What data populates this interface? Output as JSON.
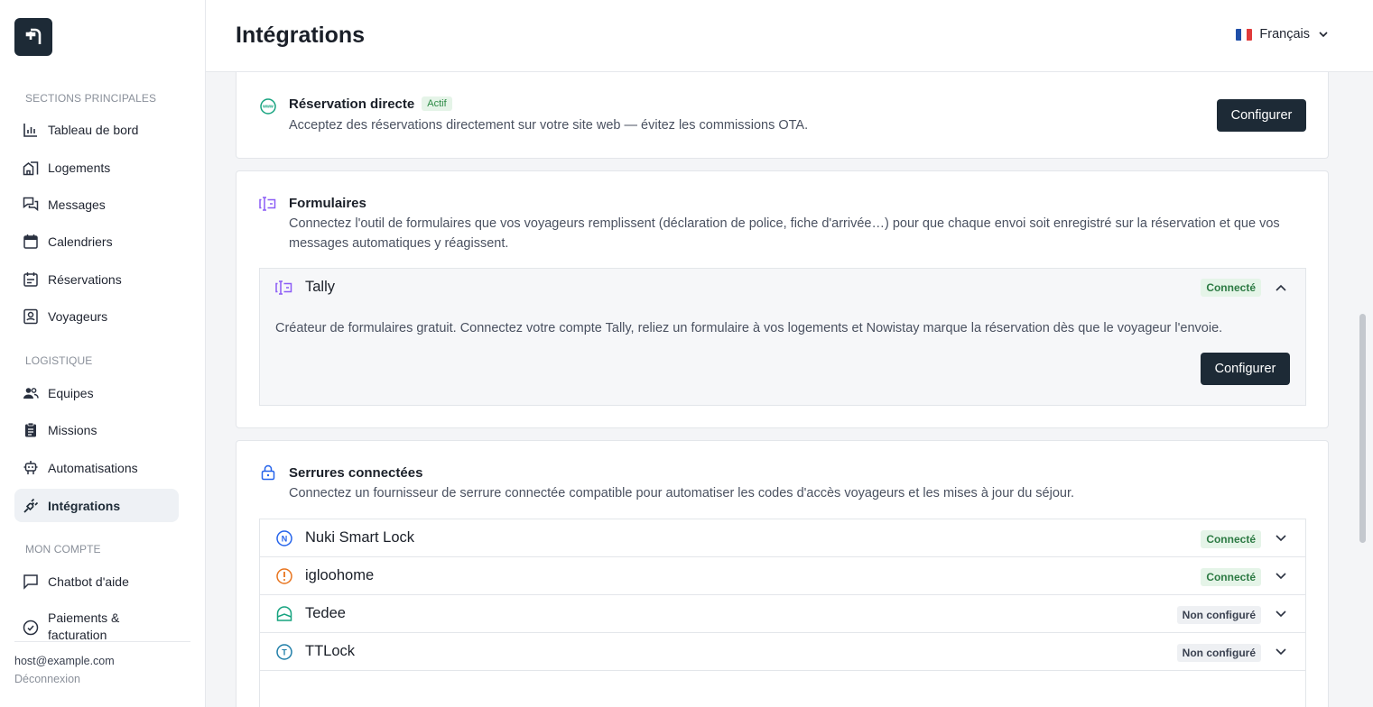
{
  "app": {
    "title": "Intégrations"
  },
  "header": {
    "language": "Français"
  },
  "sidebar": {
    "sections": [
      {
        "label": "SECTIONS PRINCIPALES"
      },
      {
        "label": "LOGISTIQUE"
      },
      {
        "label": "MON COMPTE"
      }
    ],
    "items": [
      {
        "label": "Tableau de bord",
        "icon": "bar-chart-icon"
      },
      {
        "label": "Logements",
        "icon": "buildings-icon"
      },
      {
        "label": "Messages",
        "icon": "chat-icon"
      },
      {
        "label": "Calendriers",
        "icon": "calendar-icon"
      },
      {
        "label": "Réservations",
        "icon": "reservations-icon"
      },
      {
        "label": "Voyageurs",
        "icon": "guest-icon"
      },
      {
        "label": "Equipes",
        "icon": "team-icon"
      },
      {
        "label": "Missions",
        "icon": "clipboard-icon"
      },
      {
        "label": "Automatisations",
        "icon": "robot-icon"
      },
      {
        "label": "Intégrations",
        "icon": "plug-icon",
        "active": true
      },
      {
        "label": "Chatbot d'aide",
        "icon": "chat-bubble-icon"
      },
      {
        "label": "Paiements & facturation",
        "icon": "payments-icon"
      }
    ],
    "footer": {
      "email": "host@example.com",
      "logout": "Déconnexion"
    }
  },
  "cards": {
    "direct": {
      "title": "Réservation directe",
      "badge": "Actif",
      "desc": "Acceptez des réservations directement sur votre site web — évitez les commissions OTA.",
      "button": "Configurer"
    },
    "forms": {
      "title": "Formulaires",
      "desc": "Connectez l'outil de formulaires que vos voyageurs remplissent (déclaration de police, fiche d'arrivée…) pour que chaque envoi soit enregistré sur la réservation et que vos messages automatiques y réagissent.",
      "provider": {
        "name": "Tally",
        "status": "Connecté",
        "desc": "Créateur de formulaires gratuit. Connectez votre compte Tally, reliez un formulaire à vos logements et Nowistay marque la réservation dès que le voyageur l'envoie.",
        "button": "Configurer"
      }
    },
    "locks": {
      "title": "Serrures connectées",
      "desc": "Connectez un fournisseur de serrure connectée compatible pour automatiser les codes d'accès voyageurs et les mises à jour du séjour.",
      "providers": [
        {
          "name": "Nuki Smart Lock",
          "status": "Connecté",
          "icon": "nuki-icon",
          "color": "#2563eb"
        },
        {
          "name": "igloohome",
          "status": "Connecté",
          "icon": "igloohome-icon",
          "color": "#e8741e"
        },
        {
          "name": "Tedee",
          "status": "Non configuré",
          "icon": "tedee-icon",
          "color": "#16a37f"
        },
        {
          "name": "TTLock",
          "status": "Non configuré",
          "icon": "ttlock-icon",
          "color": "#1f7ea8"
        }
      ]
    }
  },
  "colors": {
    "brand": "#1d2a36",
    "success": "#2c7a43",
    "form_icon": "#8b5cf6"
  }
}
